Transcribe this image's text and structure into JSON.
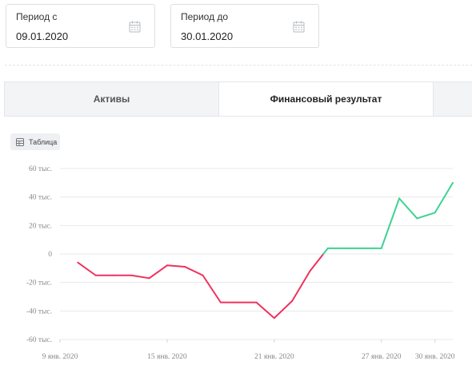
{
  "filters": {
    "from": {
      "label": "Период с",
      "value": "09.01.2020"
    },
    "to": {
      "label": "Период до",
      "value": "30.01.2020"
    }
  },
  "tabs": [
    {
      "label": "Активы",
      "active": false
    },
    {
      "label": "Финансовый результат",
      "active": true
    },
    {
      "label": "",
      "active": false
    }
  ],
  "table_button": {
    "label": "Таблица",
    "icon": "table-icon"
  },
  "colors": {
    "negative": "#f0315e",
    "positive": "#3dd394",
    "grid": "#e6e8eb"
  },
  "chart_data": {
    "type": "line",
    "title": "",
    "xlabel": "",
    "ylabel": "",
    "ylim": [
      -60000,
      60000
    ],
    "yticks": [
      {
        "value": 60000,
        "label": "60 тыс."
      },
      {
        "value": 40000,
        "label": "40 тыс."
      },
      {
        "value": 20000,
        "label": "20 тыс."
      },
      {
        "value": 0,
        "label": "0"
      },
      {
        "value": -20000,
        "label": "-20 тыс."
      },
      {
        "value": -40000,
        "label": "-40 тыс."
      },
      {
        "value": -60000,
        "label": "-60 тыс."
      }
    ],
    "xlim": [
      "2020-01-09",
      "2020-01-31"
    ],
    "xticks": [
      {
        "date": "2020-01-09",
        "label": "9 янв. 2020"
      },
      {
        "date": "2020-01-15",
        "label": "15 янв. 2020"
      },
      {
        "date": "2020-01-21",
        "label": "21 янв. 2020"
      },
      {
        "date": "2020-01-27",
        "label": "27 янв. 2020"
      },
      {
        "date": "2020-01-30",
        "label": "30 янв. 2020"
      }
    ],
    "grid": true,
    "legend": "none",
    "series": [
      {
        "x": [
          "2020-01-10",
          "2020-01-11",
          "2020-01-12",
          "2020-01-13",
          "2020-01-14",
          "2020-01-15",
          "2020-01-16",
          "2020-01-17",
          "2020-01-18",
          "2020-01-19",
          "2020-01-20",
          "2020-01-21",
          "2020-01-22",
          "2020-01-23",
          "2020-01-24",
          "2020-01-25",
          "2020-01-26",
          "2020-01-27",
          "2020-01-28",
          "2020-01-29",
          "2020-01-30"
        ],
        "y": [
          -6000,
          -15000,
          -15000,
          -15000,
          -17000,
          -8000,
          -9000,
          -15000,
          -34000,
          -34000,
          -34000,
          -45000,
          -33000,
          -12000,
          4000,
          4000,
          4000,
          4000,
          39000,
          25000,
          29000
        ]
      }
    ],
    "last_point": {
      "x": "2020-01-31",
      "y": 50000
    }
  }
}
